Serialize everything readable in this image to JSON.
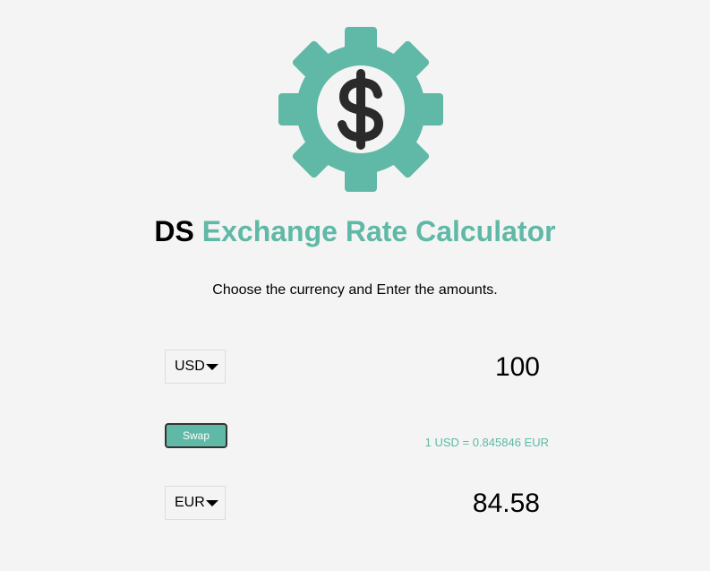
{
  "header": {
    "logo_icon": "gear-dollar-icon",
    "title_prefix": "DS",
    "title_main": "Exchange Rate Calculator",
    "accent_color": "#5fb9a6"
  },
  "instructions": "Choose the currency and Enter the amounts.",
  "currency_one": {
    "code": "USD",
    "amount": "100"
  },
  "swap": {
    "label": "Swap"
  },
  "rate_text": "1 USD = 0.845846 EUR",
  "currency_two": {
    "code": "EUR",
    "amount": "84.58"
  }
}
